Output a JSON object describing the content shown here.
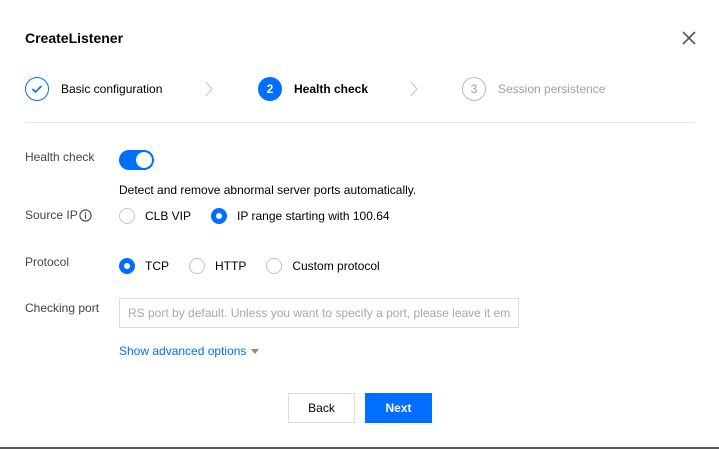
{
  "dialog": {
    "title": "CreateListener"
  },
  "steps": [
    {
      "number": "",
      "label": "Basic configuration",
      "state": "done"
    },
    {
      "number": "2",
      "label": "Health check",
      "state": "active"
    },
    {
      "number": "3",
      "label": "Session persistence",
      "state": "pending"
    }
  ],
  "form": {
    "health_check": {
      "label": "Health check",
      "enabled": true,
      "hint": "Detect and remove abnormal server ports automatically."
    },
    "source_ip": {
      "label": "Source IP",
      "options": [
        {
          "label": "CLB VIP",
          "selected": false
        },
        {
          "label": "IP range starting with 100.64",
          "selected": true
        }
      ]
    },
    "protocol": {
      "label": "Protocol",
      "options": [
        {
          "label": "TCP",
          "selected": true
        },
        {
          "label": "HTTP",
          "selected": false
        },
        {
          "label": "Custom protocol",
          "selected": false
        }
      ]
    },
    "checking_port": {
      "label": "Checking port",
      "value": "",
      "placeholder": "RS port by default. Unless you want to specify a port, please leave it em"
    },
    "advanced_link": "Show advanced options"
  },
  "footer": {
    "back_label": "Back",
    "next_label": "Next"
  },
  "colors": {
    "accent": "#006eff",
    "muted": "#a0a0a0",
    "border": "#dddddd"
  }
}
